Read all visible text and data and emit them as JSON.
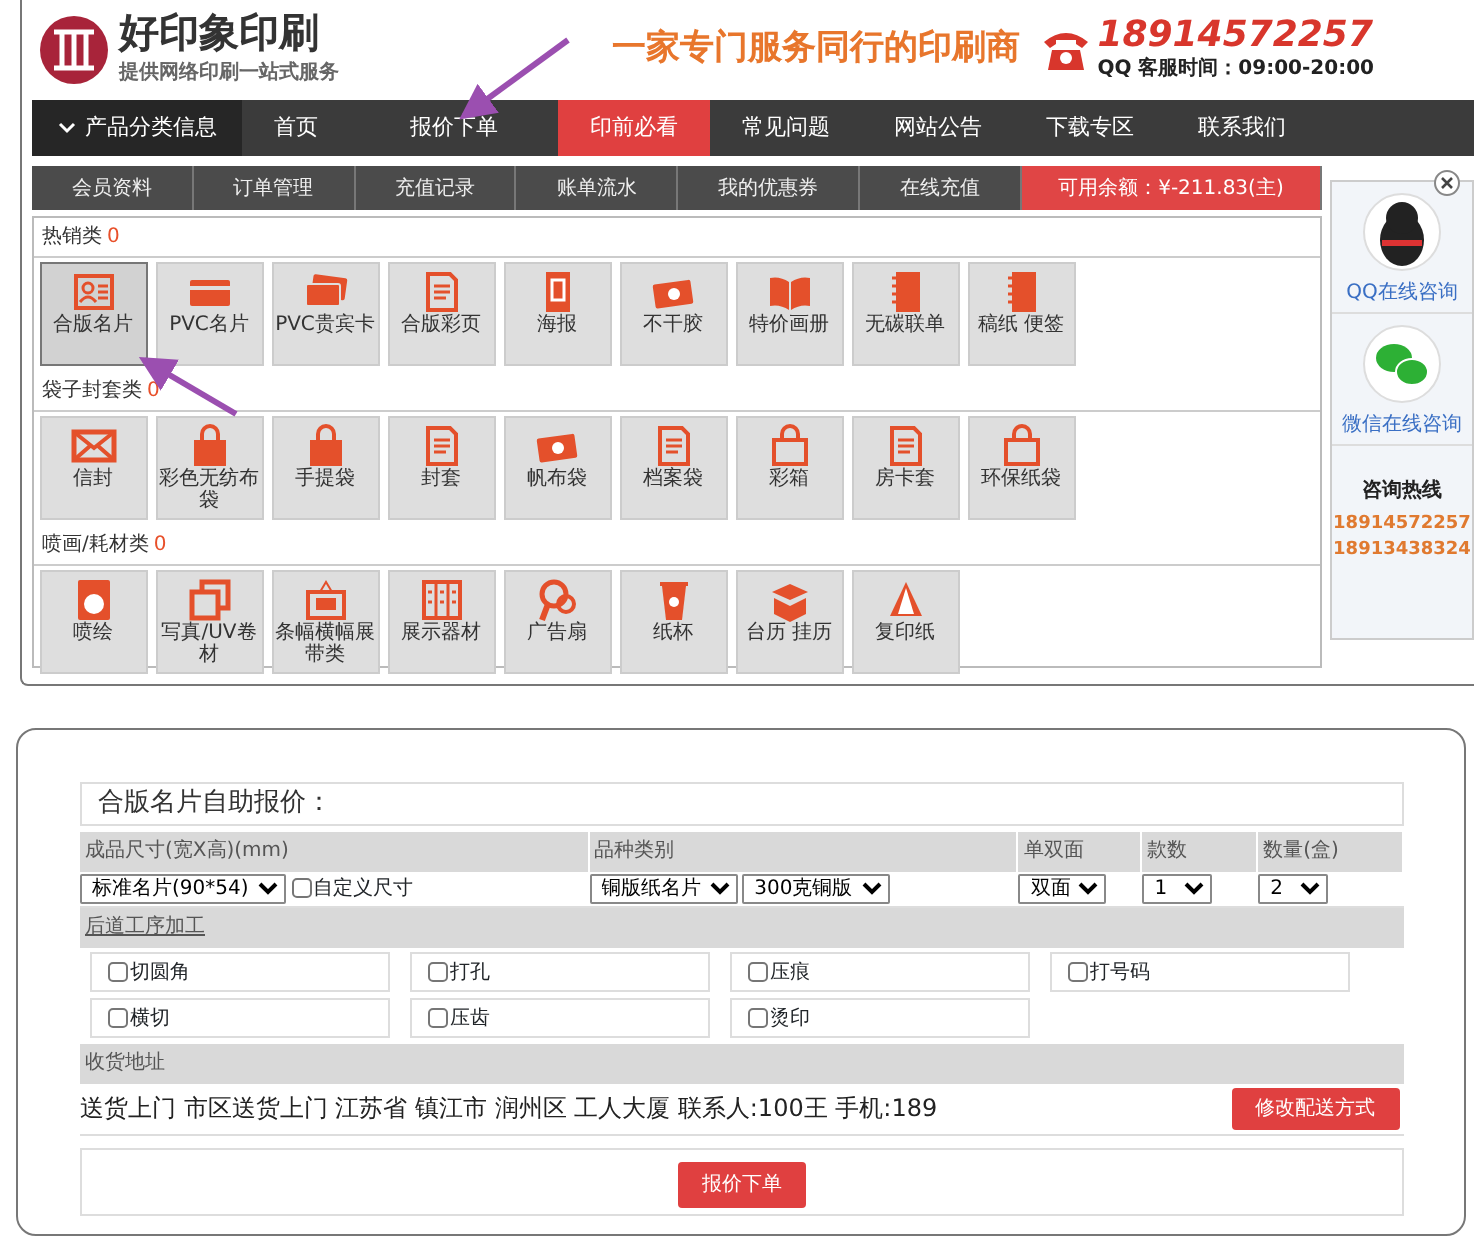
{
  "header": {
    "logo_title": "好印象印刷",
    "logo_subtitle": "提供网络印刷一站式服务",
    "slogan": "一家专门服务同行的印刷商",
    "phone": "18914572257",
    "hours": "QQ 客服时间：09:00-20:00"
  },
  "nav": {
    "category_toggle": "产品分类信息",
    "items": [
      {
        "label": "首页",
        "selected": false
      },
      {
        "label": "报价下单",
        "selected": false
      },
      {
        "label": "印前必看",
        "selected": true
      },
      {
        "label": "常见问题",
        "selected": false
      },
      {
        "label": "网站公告",
        "selected": false
      },
      {
        "label": "下载专区",
        "selected": false
      },
      {
        "label": "联系我们",
        "selected": false
      }
    ]
  },
  "subnav": {
    "items": [
      "会员资料",
      "订单管理",
      "充值记录",
      "账单流水",
      "我的优惠券",
      "在线充值"
    ],
    "balance": "可用余额：¥-211.83(主)"
  },
  "categories": [
    {
      "title": "热销类",
      "count": "0",
      "products": [
        {
          "label": "合版名片",
          "selected": true
        },
        {
          "label": "PVC名片",
          "selected": false
        },
        {
          "label": "PVC贵宾卡",
          "selected": false
        },
        {
          "label": "合版彩页",
          "selected": false
        },
        {
          "label": "海报",
          "selected": false
        },
        {
          "label": "不干胶",
          "selected": false
        },
        {
          "label": "特价画册",
          "selected": false
        },
        {
          "label": "无碳联单",
          "selected": false
        },
        {
          "label": "稿纸 便签",
          "selected": false
        }
      ]
    },
    {
      "title": "袋子封套类",
      "count": "0",
      "products": [
        {
          "label": "信封",
          "selected": false
        },
        {
          "label": "彩色无纺布袋",
          "selected": false
        },
        {
          "label": "手提袋",
          "selected": false
        },
        {
          "label": "封套",
          "selected": false
        },
        {
          "label": "帆布袋",
          "selected": false
        },
        {
          "label": "档案袋",
          "selected": false
        },
        {
          "label": "彩箱",
          "selected": false
        },
        {
          "label": "房卡套",
          "selected": false
        },
        {
          "label": "环保纸袋",
          "selected": false
        }
      ]
    },
    {
      "title": "喷画/耗材类",
      "count": "0",
      "products": [
        {
          "label": "喷绘",
          "selected": false
        },
        {
          "label": "写真/UV卷材",
          "selected": false
        },
        {
          "label": "条幅横幅展带类",
          "selected": false
        },
        {
          "label": "展示器材",
          "selected": false
        },
        {
          "label": "广告扇",
          "selected": false
        },
        {
          "label": "纸杯",
          "selected": false
        },
        {
          "label": "台历 挂历",
          "selected": false
        },
        {
          "label": "复印纸",
          "selected": false
        }
      ]
    }
  ],
  "sidebar": {
    "qq_label": "QQ在线咨询",
    "wechat_label": "微信在线咨询",
    "hotline_title": "咨询热线",
    "phones": [
      "18914572257",
      "18913438324"
    ]
  },
  "quote_form": {
    "title": "合版名片自助报价：",
    "columns": [
      "成品尺寸(宽X高)(mm)",
      "品种类别",
      "单双面",
      "款数",
      "数量(盒)"
    ],
    "size_select": "标准名片(90*54)",
    "custom_size": {
      "label": "自定义尺寸",
      "checked": false
    },
    "paper_select": "铜版纸名片",
    "weight_select": "300克铜版",
    "sides_select": "双面",
    "styles_select": "1",
    "quantity_select": "2",
    "finishing_title": "后道工序加工",
    "finishing_options": [
      {
        "label": "切圆角",
        "checked": false
      },
      {
        "label": "打孔",
        "checked": false
      },
      {
        "label": "压痕",
        "checked": false
      },
      {
        "label": "打号码",
        "checked": false
      },
      {
        "label": "横切",
        "checked": false
      },
      {
        "label": "压齿",
        "checked": false
      },
      {
        "label": "烫印",
        "checked": false
      }
    ],
    "address_title": "收货地址",
    "address": "送货上门 市区送货上门 江苏省 镇江市 润州区 工人大厦 联系人:100王 手机:189",
    "change_delivery_button": "修改配送方式",
    "submit_button": "报价下单"
  }
}
